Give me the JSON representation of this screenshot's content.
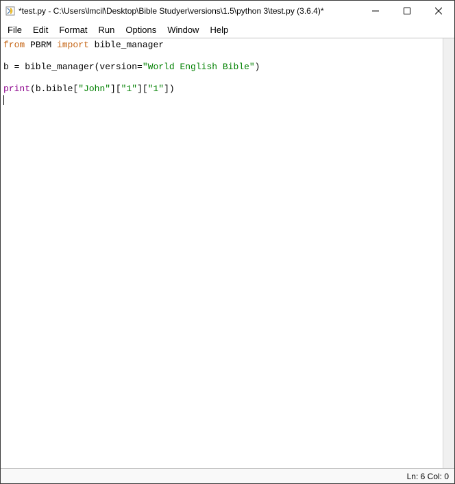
{
  "titlebar": {
    "title": "*test.py - C:\\Users\\lmcil\\Desktop\\Bible Studyer\\versions\\1.5\\python 3\\test.py (3.6.4)*"
  },
  "menu": {
    "items": [
      "File",
      "Edit",
      "Format",
      "Run",
      "Options",
      "Window",
      "Help"
    ]
  },
  "code": {
    "l1": {
      "t1": "from",
      "t2": " PBRM ",
      "t3": "import",
      "t4": " bible_manager"
    },
    "l2": "",
    "l3": {
      "t1": "b = bible_manager(version=",
      "t2": "\"World English Bible\"",
      "t3": ")"
    },
    "l4": "",
    "l5": {
      "t1": "print",
      "t2": "(b.bible[",
      "t3": "\"John\"",
      "t4": "][",
      "t5": "\"1\"",
      "t6": "][",
      "t7": "\"1\"",
      "t8": "])"
    }
  },
  "status": {
    "text": "Ln: 6  Col: 0"
  }
}
